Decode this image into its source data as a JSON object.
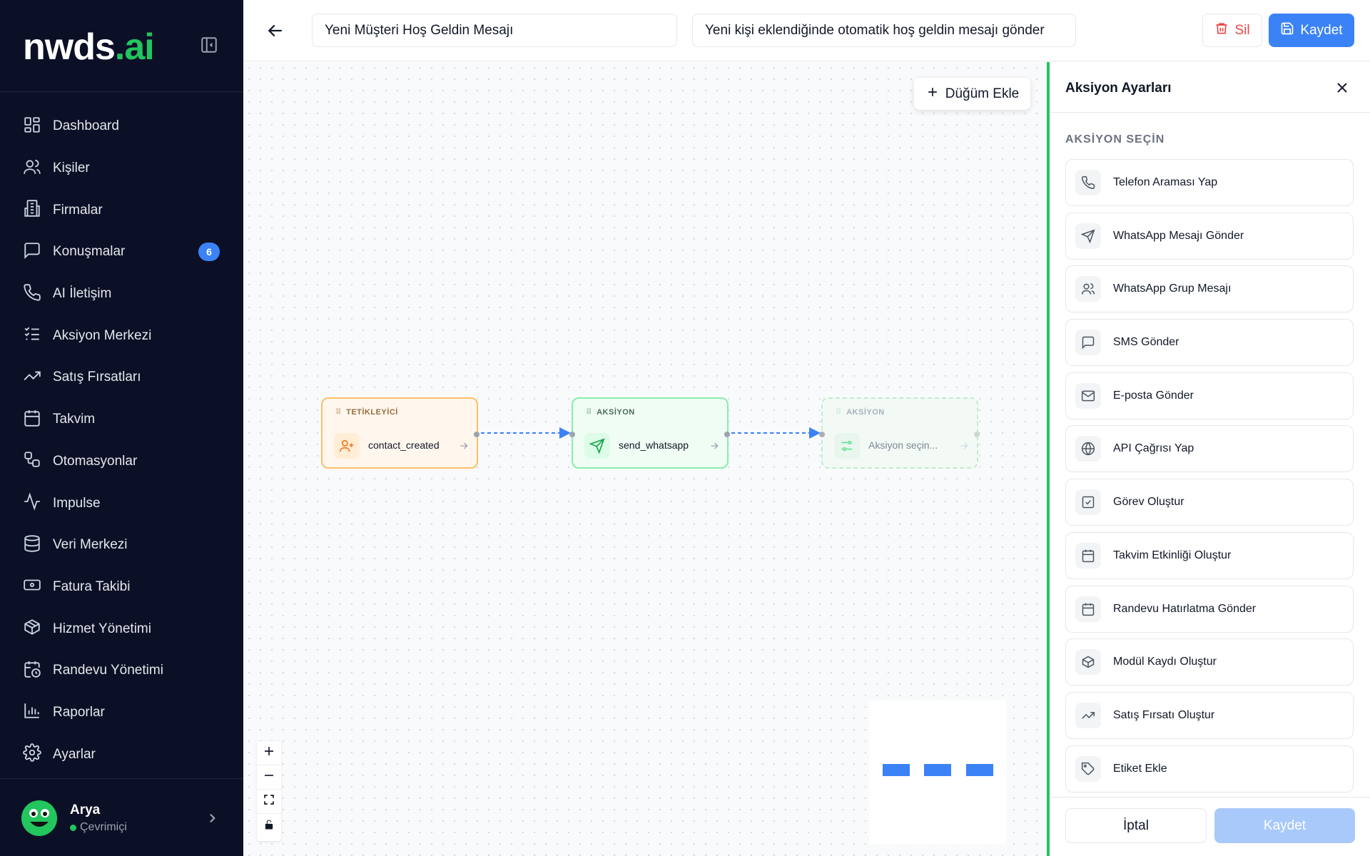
{
  "brand": {
    "name_part1": "nwds",
    "name_part2": ".ai"
  },
  "sidebar": {
    "items": [
      {
        "label": "Dashboard",
        "icon": "dashboard-icon"
      },
      {
        "label": "Kişiler",
        "icon": "users-icon"
      },
      {
        "label": "Firmalar",
        "icon": "building-icon"
      },
      {
        "label": "Konuşmalar",
        "icon": "chat-icon",
        "badge": "6"
      },
      {
        "label": "AI İletişim",
        "icon": "phone-icon"
      },
      {
        "label": "Aksiyon Merkezi",
        "icon": "list-checks-icon"
      },
      {
        "label": "Satış Fırsatları",
        "icon": "trending-up-icon"
      },
      {
        "label": "Takvim",
        "icon": "calendar-icon"
      },
      {
        "label": "Otomasyonlar",
        "icon": "workflow-icon"
      },
      {
        "label": "Impulse",
        "icon": "activity-icon"
      },
      {
        "label": "Veri Merkezi",
        "icon": "database-icon"
      },
      {
        "label": "Fatura Takibi",
        "icon": "banknote-icon"
      },
      {
        "label": "Hizmet Yönetimi",
        "icon": "package-icon"
      },
      {
        "label": "Randevu Yönetimi",
        "icon": "calendar-clock-icon"
      },
      {
        "label": "Raporlar",
        "icon": "bar-chart-icon"
      },
      {
        "label": "Ayarlar",
        "icon": "gear-icon"
      }
    ],
    "user": {
      "name": "Arya",
      "status": "Çevrimiçi"
    }
  },
  "header": {
    "name_value": "Yeni Müşteri Hoş Geldin Mesajı",
    "description_value": "Yeni kişi eklendiğinde otomatik hoş geldin mesajı gönder",
    "delete_label": "Sil",
    "save_label": "Kaydet"
  },
  "canvas": {
    "add_node_label": "Düğüm Ekle",
    "nodes": [
      {
        "type_label": "TETİKLEYİCİ",
        "text": "contact_created",
        "icon": "user-plus-icon"
      },
      {
        "type_label": "AKSİYON",
        "text": "send_whatsapp",
        "icon": "send-icon"
      },
      {
        "type_label": "AKSİYON",
        "text": "Aksiyon seçin...",
        "icon": "sliders-icon"
      }
    ]
  },
  "panel": {
    "title": "Aksiyon Ayarları",
    "section_label": "AKSİYON SEÇİN",
    "actions": [
      {
        "label": "Telefon Araması Yap",
        "icon": "phone-icon"
      },
      {
        "label": "WhatsApp Mesajı Gönder",
        "icon": "send-icon"
      },
      {
        "label": "WhatsApp Grup Mesajı",
        "icon": "users-icon"
      },
      {
        "label": "SMS Gönder",
        "icon": "message-square-icon"
      },
      {
        "label": "E-posta Gönder",
        "icon": "mail-icon"
      },
      {
        "label": "API Çağrısı Yap",
        "icon": "globe-icon"
      },
      {
        "label": "Görev Oluştur",
        "icon": "check-square-icon"
      },
      {
        "label": "Takvim Etkinliği Oluştur",
        "icon": "calendar-icon"
      },
      {
        "label": "Randevu Hatırlatma Gönder",
        "icon": "calendar-icon"
      },
      {
        "label": "Modül Kaydı Oluştur",
        "icon": "package-icon"
      },
      {
        "label": "Satış Fırsatı Oluştur",
        "icon": "trending-up-icon"
      },
      {
        "label": "Etiket Ekle",
        "icon": "tag-icon"
      }
    ],
    "cancel_label": "İptal",
    "save_label": "Kaydet"
  },
  "colors": {
    "accent": "#3b82f6",
    "success": "#22c55e",
    "danger": "#ef4444",
    "sidebar_bg": "#0c1026"
  }
}
